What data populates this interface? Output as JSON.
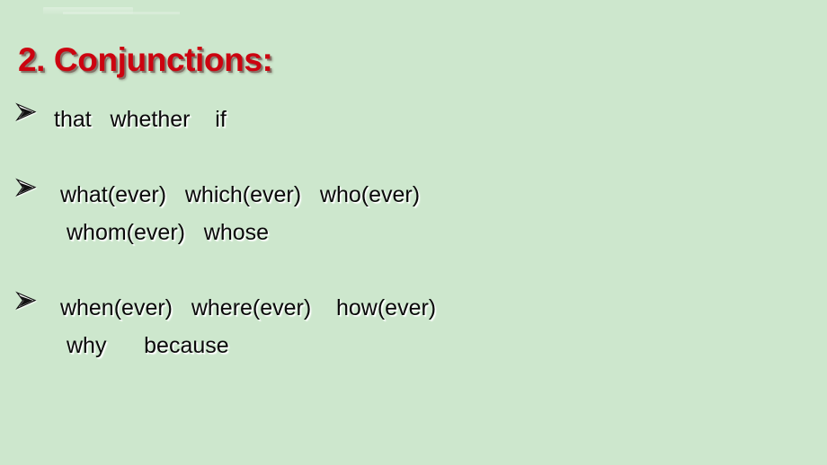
{
  "slide": {
    "background_color": "#cde7cd",
    "title": {
      "text": "2. Conjunctions:",
      "color": "#cc0410"
    },
    "bullet_marker_icon": "arrowhead-bullet-icon",
    "bullets": [
      {
        "marker": "➢",
        "lines": [
          "that   whether    if"
        ]
      },
      {
        "marker": "➢",
        "lines": [
          " what(ever)   which(ever)   who(ever)",
          "whom(ever)   whose"
        ]
      },
      {
        "marker": "➢",
        "lines": [
          " when(ever)   where(ever)    how(ever)",
          "why      because"
        ]
      }
    ]
  }
}
